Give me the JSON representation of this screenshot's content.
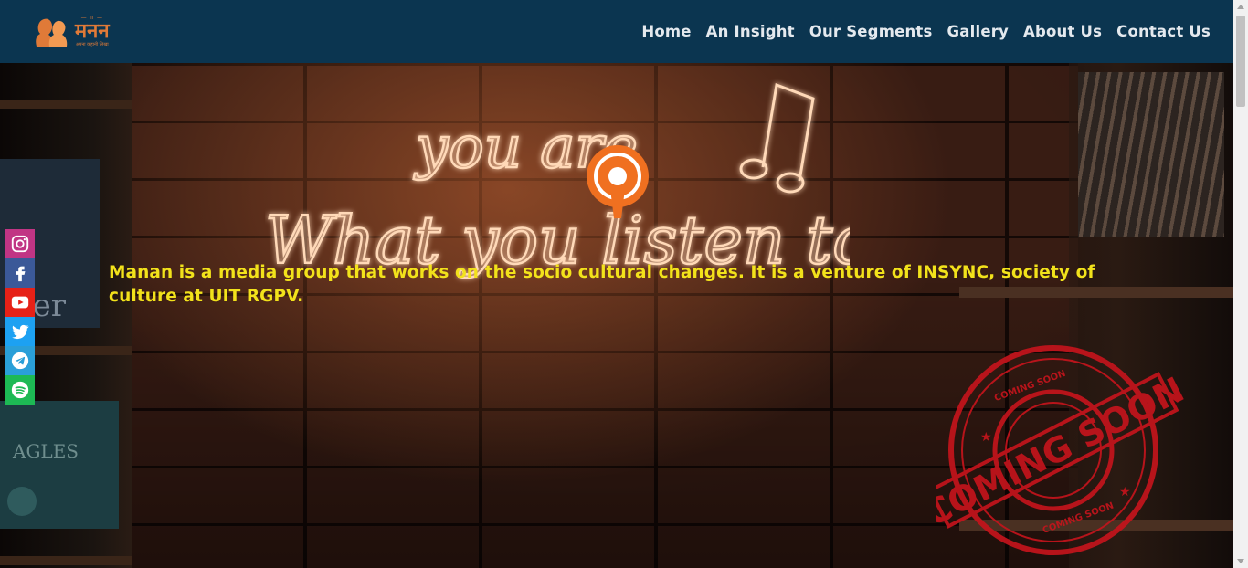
{
  "brand": {
    "name": "मनन",
    "top_text": "— ॥ —",
    "tagline": "अपना कहानी लिखा",
    "color": "#e07a38",
    "icon": "two-heads-logo"
  },
  "nav": {
    "background": "#0b3550",
    "links": [
      {
        "label": "Home"
      },
      {
        "label": "An Insight"
      },
      {
        "label": "Our Segments"
      },
      {
        "label": "Gallery"
      },
      {
        "label": "About Us"
      },
      {
        "label": "Contact Us"
      }
    ]
  },
  "hero": {
    "description": "Manan is a media group that works on the socio cultural changes. It is a venture of INSYNC, society of culture at UIT RGPV.",
    "description_color": "#f2e21b",
    "neon": {
      "line1": "you are",
      "line2": "What you listen to",
      "icon": "podcast-icon",
      "note_icon": "music-note-icon"
    },
    "stamp": {
      "main": "COMING SOON",
      "ring_top": "COMING SOON",
      "ring_bottom": "COMING SOON",
      "color": "#c4141c"
    },
    "background_book_texts": [
      "ter",
      "AGLES"
    ]
  },
  "social": [
    {
      "name": "instagram",
      "color": "#c13584",
      "icon": "instagram-icon"
    },
    {
      "name": "facebook",
      "color": "#3b5998",
      "icon": "facebook-icon"
    },
    {
      "name": "youtube",
      "color": "#e62117",
      "icon": "youtube-icon"
    },
    {
      "name": "twitter",
      "color": "#1da1f2",
      "icon": "twitter-icon"
    },
    {
      "name": "telegram",
      "color": "#2a9fd8",
      "icon": "telegram-icon"
    },
    {
      "name": "spotify",
      "color": "#1db954",
      "icon": "spotify-icon"
    }
  ]
}
